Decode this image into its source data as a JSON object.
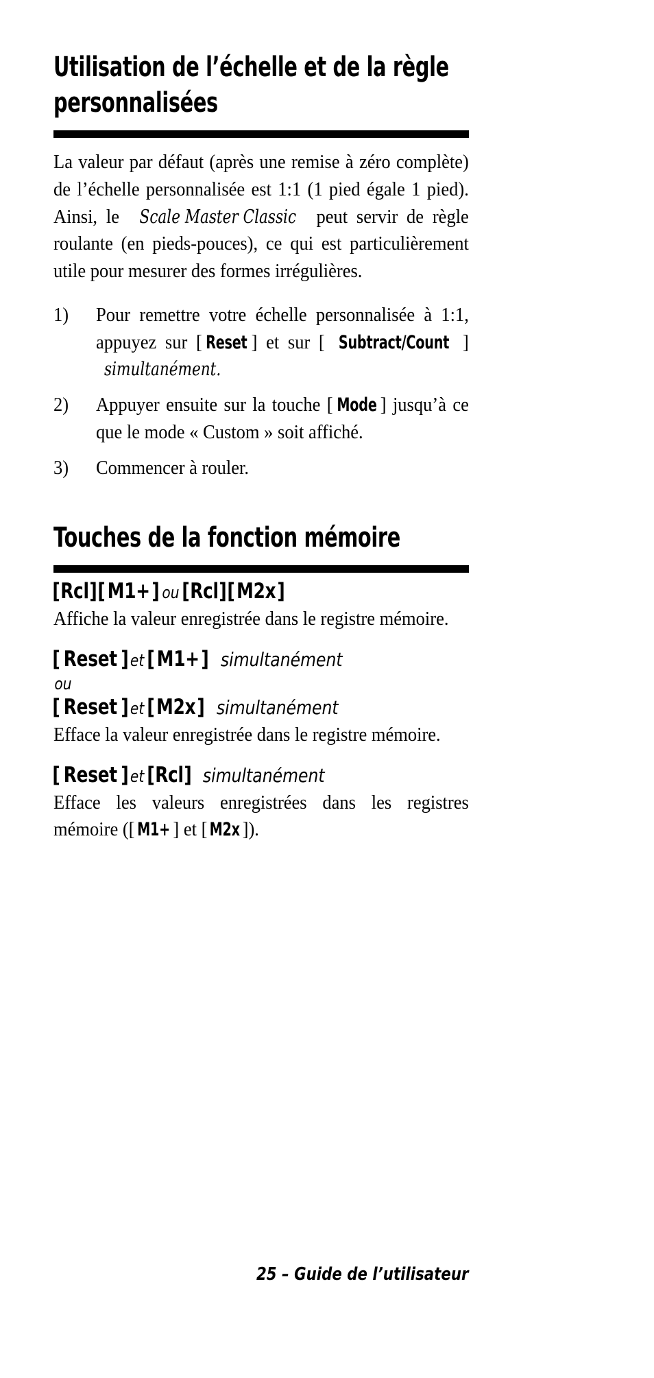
{
  "page": {
    "number": "25",
    "footer_text": "25 – Guide de l’utilisateur"
  },
  "section1": {
    "title_line1": "Utilisation de l’échelle et de la règle",
    "title_line2": "personnalisées",
    "intro_part1": "La valeur par défaut (après une remise à zéro complète) de l’échelle personnalisée est 1:1 (1 pied égale 1 pied). Ainsi, le ",
    "intro_product": "Scale Master Classic",
    "intro_part2": " peut servir de règle roulante (en pieds-pouces), ce qui est particulièrement utile pour mesurer des formes irrégulières.",
    "steps": [
      {
        "number": "1)",
        "text_part1": "Pour remettre votre échelle personnalisée à 1:1, appuyez sur ",
        "key1": "Reset",
        "text_part2": " et sur ",
        "key2": "Subtract/Count",
        "emphasis": "simultanément."
      },
      {
        "number": "2)",
        "text_part1": "Appuyer ensuite sur la touche ",
        "key1": "Mode",
        "text_part2": " jusqu’à ce que le mode « Custom » soit affiché.",
        "key2": "",
        "emphasis": ""
      },
      {
        "number": "3)",
        "text_part1": "Commencer à rouler.",
        "key1": "",
        "text_part2": "",
        "key2": "",
        "emphasis": ""
      }
    ]
  },
  "section2": {
    "title": "Touches de la fonction mémoire",
    "entries": [
      {
        "head_keys": [
          "Rcl",
          "M1+"
        ],
        "head_conj": "ou",
        "head_keys2": [
          "Rcl",
          "M2x"
        ],
        "body": "Affiche la valeur enregistrée dans le registre mémoire."
      },
      {
        "head_key_a": "Reset",
        "head_conj": "et",
        "head_key_b": "M1+",
        "head_emph": "simultanément",
        "head_or": "ou",
        "head_key_a2": "Reset",
        "head_conj2": "et",
        "head_key_b2": "M2x",
        "head_emph2": "simultanément",
        "body": "Efface la valeur enregistrée dans le registre mémoire."
      },
      {
        "head_key_a": "Reset",
        "head_conj": "et",
        "head_key_b": "Rcl",
        "head_emph": "simultanément",
        "body_part1": "Efface les valeurs enregistrées dans les registres mémoire (",
        "body_key1": "M1+",
        "body_mid": " et ",
        "body_key2": "M2x",
        "body_part2": ")."
      }
    ]
  },
  "brackets": {
    "open": "[",
    "close": "]"
  }
}
